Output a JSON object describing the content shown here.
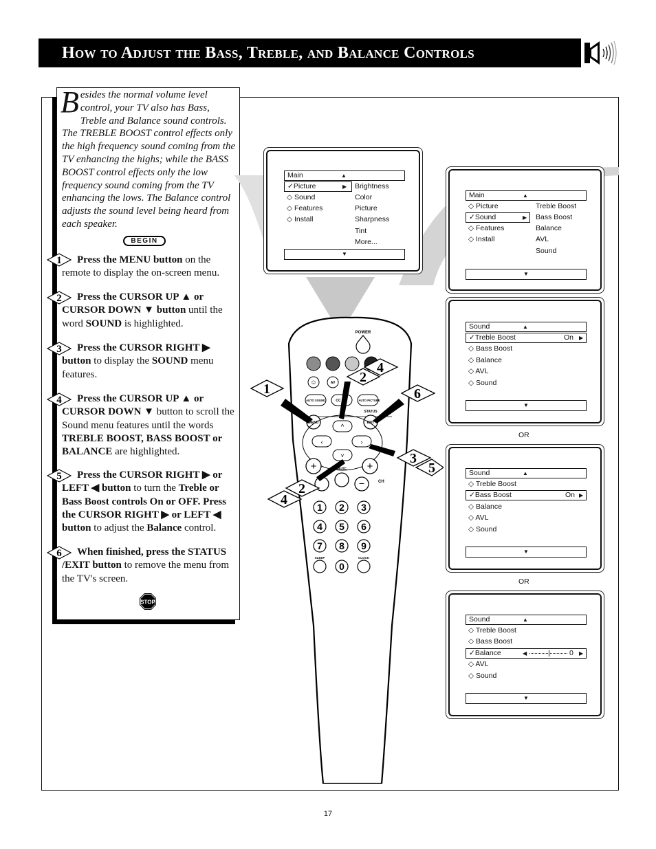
{
  "header": {
    "title": "How to Adjust the Bass, Treble, and Balance Controls",
    "icon": "speaker-sound-icon"
  },
  "intro": {
    "dropcap": "B",
    "text": "esides the normal volume level control, your TV also has Bass, Treble and Balance sound controls. The TREBLE BOOST control effects only the high frequency sound coming from the TV enhancing the highs; while the BASS BOOST control effects only the low frequency sound coming from the TV enhancing the lows. The Balance control adjusts the sound level being heard from each speaker.",
    "begin_label": "BEGIN"
  },
  "steps": [
    {
      "number": "1",
      "bold": "Press the MENU button",
      "text": " on the remote to display the on-screen menu."
    },
    {
      "number": "2",
      "bold": "Press the CURSOR UP ▲ or CURSOR DOWN ▼ button",
      "text": " until the word ",
      "bold2": "SOUND",
      "text2": " is highlighted."
    },
    {
      "number": "3",
      "bold": "Press the CURSOR RIGHT ▶ button",
      "text": " to display the ",
      "bold2": "SOUND",
      "text2": " menu features."
    },
    {
      "number": "4",
      "bold": "Press the CURSOR UP ▲ or CURSOR DOWN ▼",
      "text": " button to scroll the Sound menu features until the words ",
      "bold2": "TREBLE BOOST, BASS BOOST or BALANCE",
      "text2": " are highlighted."
    },
    {
      "number": "5",
      "bold": "Press the CURSOR RIGHT ▶ or LEFT ◀  button",
      "text": " to turn the ",
      "bold2": "Treble or Bass Boost controls On or OFF. Press the CURSOR RIGHT ▶ or LEFT ◀ button",
      "text2": " to adjust the  ",
      "bold3": "Balance",
      "text3": " control."
    },
    {
      "number": "6",
      "bold": "When finished, press the STATUS /EXIT button",
      "text": " to remove the menu from the TV's screen."
    }
  ],
  "stop_label": "STOP",
  "screens": {
    "main_picture": {
      "header": "Main",
      "items": [
        {
          "label": "Picture",
          "selected": true
        },
        {
          "label": "Sound",
          "selected": false
        },
        {
          "label": "Features",
          "selected": false
        },
        {
          "label": "Install",
          "selected": false
        }
      ],
      "submenu": [
        "Brightness",
        "Color",
        "Picture",
        "Sharpness",
        "Tint",
        "More..."
      ]
    },
    "main_sound": {
      "header": "Main",
      "items": [
        {
          "label": "Picture",
          "selected": false
        },
        {
          "label": "Sound",
          "selected": true
        },
        {
          "label": "Features",
          "selected": false
        },
        {
          "label": "Install",
          "selected": false
        }
      ],
      "submenu": [
        "Treble Boost",
        "Bass Boost",
        "Balance",
        "AVL",
        "Sound"
      ]
    },
    "sound_treble": {
      "header": "Sound",
      "items": [
        {
          "label": "Treble Boost",
          "selected": true,
          "value": "On"
        },
        {
          "label": "Bass Boost",
          "selected": false
        },
        {
          "label": "Balance",
          "selected": false
        },
        {
          "label": "AVL",
          "selected": false
        },
        {
          "label": "Sound",
          "selected": false
        }
      ]
    },
    "sound_bass": {
      "header": "Sound",
      "items": [
        {
          "label": "Treble Boost",
          "selected": false
        },
        {
          "label": "Bass Boost",
          "selected": true,
          "value": "On"
        },
        {
          "label": "Balance",
          "selected": false
        },
        {
          "label": "AVL",
          "selected": false
        },
        {
          "label": "Sound",
          "selected": false
        }
      ]
    },
    "sound_balance": {
      "header": "Sound",
      "items": [
        {
          "label": "Treble Boost",
          "selected": false
        },
        {
          "label": "Bass Boost",
          "selected": false
        },
        {
          "label": "Balance",
          "selected": true,
          "value": "0",
          "slider_position": 0.5
        },
        {
          "label": "AVL",
          "selected": false
        },
        {
          "label": "Sound",
          "selected": false
        }
      ]
    }
  },
  "or_label": "OR",
  "remote": {
    "power_label": "POWER",
    "buttons": {
      "auto_sound": "AUTO SOUND",
      "cc": "CC",
      "auto_picture": "AUTO PICTURE",
      "av": "AV",
      "menu": "MENU",
      "status": "STATUS",
      "exit": "EXIT",
      "mute": "MUTE",
      "ch": "CH",
      "sleep": "SLEEP",
      "clock": "CLOCK"
    },
    "digits": [
      "1",
      "2",
      "3",
      "4",
      "5",
      "6",
      "7",
      "8",
      "9",
      "0"
    ],
    "color_buttons": [
      "#8c8c8c",
      "#555555",
      "#c8c8c8",
      "#222222"
    ],
    "callouts": [
      "1",
      "2",
      "4",
      "6",
      "3",
      "5",
      "2",
      "4"
    ]
  },
  "page_number": "17"
}
